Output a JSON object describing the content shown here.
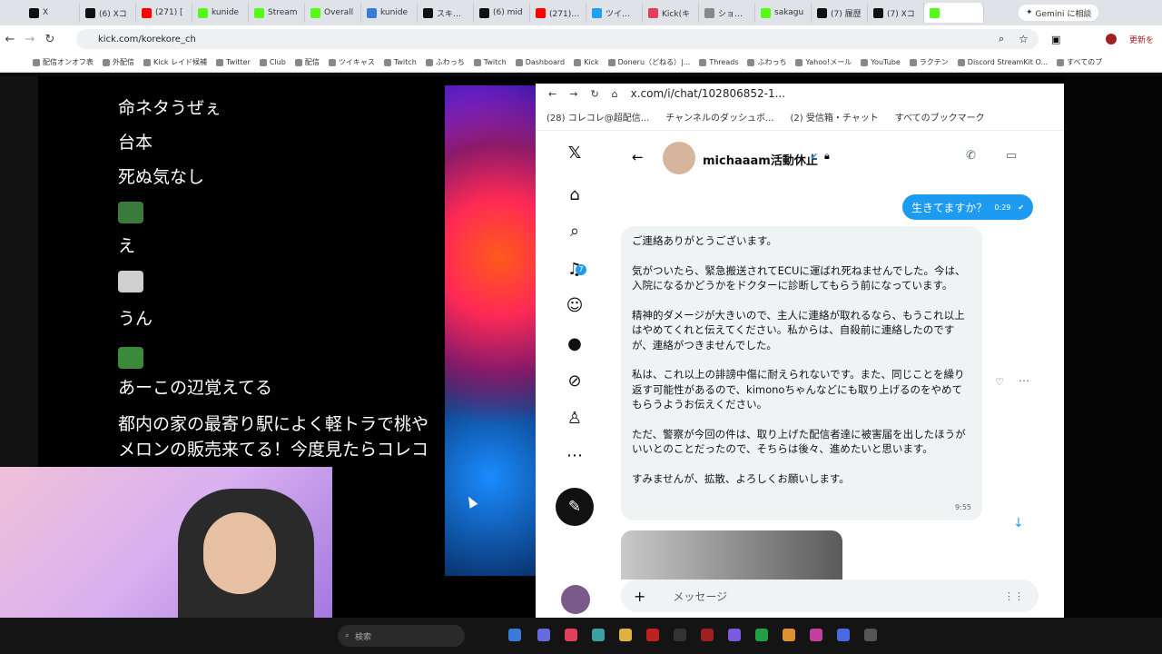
{
  "browser": {
    "tabs": [
      {
        "label": "X",
        "color": "#111111"
      },
      {
        "label": "(6) Xコ",
        "color": "#111111"
      },
      {
        "label": "(271) [",
        "color": "#ff0000"
      },
      {
        "label": "kunide",
        "color": "#53fc18"
      },
      {
        "label": "Stream",
        "color": "#53fc18"
      },
      {
        "label": "Overall",
        "color": "#53fc18"
      },
      {
        "label": "kunide",
        "color": "#3a7bd5"
      },
      {
        "label": "スキッパ",
        "color": "#111111"
      },
      {
        "label": "(6) mid",
        "color": "#111111"
      },
      {
        "label": "(271) 新",
        "color": "#ff0000"
      },
      {
        "label": "ツイキャ",
        "color": "#1da1f2"
      },
      {
        "label": "Kick(キ",
        "color": "#e0405a"
      },
      {
        "label": "ショボン",
        "color": "#888888"
      },
      {
        "label": "sakagu",
        "color": "#53fc18"
      },
      {
        "label": "(7) 履歴",
        "color": "#111111"
      },
      {
        "label": "(7) Xコ",
        "color": "#111111"
      },
      {
        "label": "",
        "color": "#53fc18"
      }
    ],
    "gemini_label": "Gemini に相談",
    "url": "kick.com/korekore_ch",
    "update_label": "更新を",
    "bookmarks": [
      "配信オンオフ表",
      "外配信",
      "Kick レイド候補",
      "Twitter",
      "Club",
      "配信",
      "ツイキャス",
      "Twitch",
      "ふわっち",
      "Twitch",
      "Dashboard",
      "Kick",
      "Doneru（どねる）|...",
      "Threads",
      "ふわっち",
      "Yahoo!メール",
      "YouTube",
      "ラクテン",
      "Discord StreamKit O...",
      "すべてのブ"
    ]
  },
  "stream": {
    "chat_lines": [
      {
        "text": "命ネタうぜぇ",
        "kind": "text"
      },
      {
        "text": "台本",
        "kind": "text"
      },
      {
        "text": "死ぬ気なし",
        "kind": "text"
      },
      {
        "text": "",
        "kind": "emote",
        "color": "#3a7a3a"
      },
      {
        "text": "え",
        "kind": "text"
      },
      {
        "text": "",
        "kind": "emote",
        "color": "#cfcfcf"
      },
      {
        "text": "うん",
        "kind": "text"
      },
      {
        "text": "",
        "kind": "emote",
        "color": "#3a8a3a"
      },
      {
        "text": "あーこの辺覚えてる",
        "kind": "text"
      },
      {
        "text": "都内の家の最寄り駅によく軽トラで桃や",
        "kind": "text"
      },
      {
        "text": "メロンの販売来てる！今度見たらコレコ",
        "kind": "text"
      }
    ]
  },
  "x_window": {
    "url": "x.com/i/chat/102806852-1...",
    "bookmarks": [
      "(28) コレコレ@超配信...",
      "チャンネルのダッシュボ...",
      "(2) 受信箱・チャット",
      "すべてのブックマーク"
    ],
    "notification_count": "7",
    "dm": {
      "contact_name": "michaaam活動休止",
      "outgoing": {
        "text": "生きてますか？",
        "time": "0:29"
      },
      "incoming_paragraphs": [
        "ご連絡ありがとうございます。",
        "気がついたら、緊急搬送されてECUに運ばれ死ねませんでした。今は、入院になるかどうかをドクターに診断してもらう前になっています。",
        "精神的ダメージが大きいので、主人に連絡が取れるなら、もうこれ以上はやめてくれと伝えてください。私からは、自殺前に連絡したのですが、連絡がつきませんでした。",
        "私は、これ以上の誹謗中傷に耐えられないです。また、同じことを繰り返す可能性があるので、kimonoちゃんなどにも取り上げるのをやめてもらうようお伝えください。",
        "ただ、警察が今回の件は、取り上げた配信者達に被害届を出したほうがいいとのことだったので、そちらは後々、進めたいと思います。",
        "すみませんが、拡散、よろしくお願いします。"
      ],
      "incoming_time": "9:55",
      "message_placeholder": "メッセージ"
    }
  },
  "taskbar": {
    "search_label": "検索"
  }
}
